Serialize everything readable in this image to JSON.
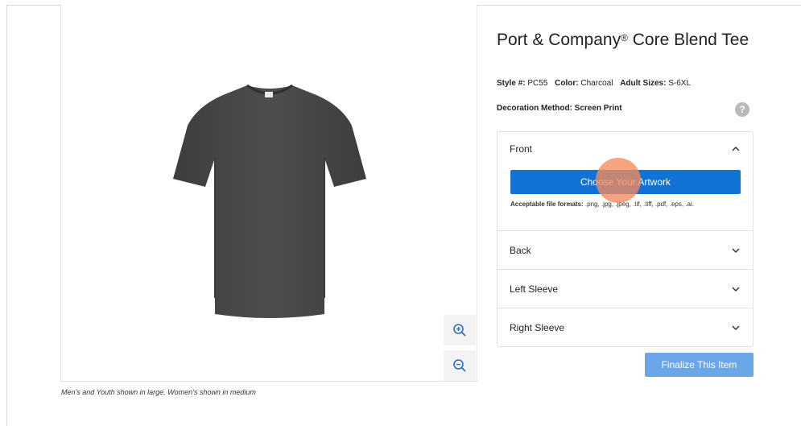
{
  "product": {
    "title_main": "Port & Company",
    "title_mark": "®",
    "title_rest": " Core Blend Tee",
    "style_label": "Style #:",
    "style_value": "PC55",
    "color_label": "Color:",
    "color_value": "Charcoal",
    "sizes_label": "Adult Sizes:",
    "sizes_value": "S-6XL",
    "decoration": "Decoration Method: Screen Print",
    "help_glyph": "?",
    "garment_color": "#4a4b4a"
  },
  "preview": {
    "caption": "Men's and Youth shown in large, Women's shown in medium",
    "zoom_in_icon": "zoom-in-icon",
    "zoom_out_icon": "zoom-out-icon"
  },
  "accordion": {
    "front": {
      "label": "Front",
      "button": "Choose Your Artwork",
      "formats_label": "Acceptable file formats:",
      "formats_value": " .png, .jpg, .jpeg, .tif, .tiff, .pdf, .eps, .ai."
    },
    "rows": [
      "Back",
      "Left Sleeve",
      "Right Sleeve"
    ]
  },
  "actions": {
    "finalize": "Finalize This Item"
  },
  "colors": {
    "primary": "#1273d6",
    "primary_disabled": "#6aa6e8",
    "cursor": "#f48a5c"
  }
}
